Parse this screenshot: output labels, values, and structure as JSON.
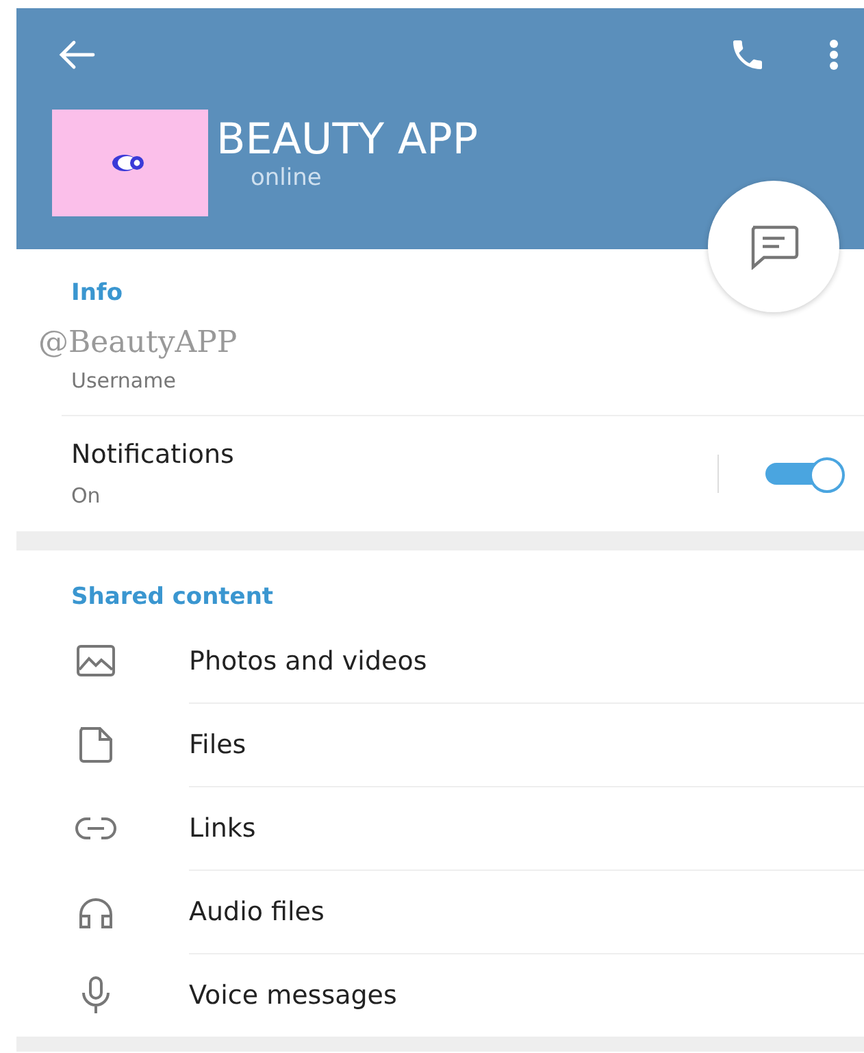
{
  "header": {
    "title": "BEAUTY APP",
    "status": "online"
  },
  "info": {
    "heading": "Info",
    "username": "@BeautyAPP",
    "username_label": "Username",
    "notifications": {
      "label": "Notifications",
      "value": "On",
      "on": true
    }
  },
  "shared": {
    "heading": "Shared content",
    "items": [
      {
        "kind": "photos",
        "label": "Photos and videos"
      },
      {
        "kind": "files",
        "label": "Files"
      },
      {
        "kind": "links",
        "label": "Links"
      },
      {
        "kind": "audio",
        "label": "Audio files"
      },
      {
        "kind": "voice",
        "label": "Voice messages"
      }
    ]
  }
}
